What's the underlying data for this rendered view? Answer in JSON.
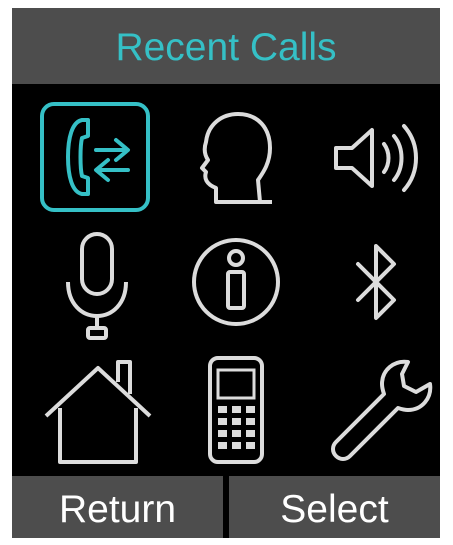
{
  "title": "Recent Calls",
  "softkeys": {
    "left_label": "Return",
    "right_label": "Select"
  },
  "menu": {
    "items": [
      {
        "icon": "call-transfer-icon",
        "selected": true
      },
      {
        "icon": "contact-profile-icon",
        "selected": false
      },
      {
        "icon": "speaker-volume-icon",
        "selected": false
      },
      {
        "icon": "microphone-icon",
        "selected": false
      },
      {
        "icon": "info-icon",
        "selected": false
      },
      {
        "icon": "bluetooth-icon",
        "selected": false
      },
      {
        "icon": "home-icon",
        "selected": false
      },
      {
        "icon": "handset-phone-icon",
        "selected": false
      },
      {
        "icon": "wrench-settings-icon",
        "selected": false
      }
    ]
  },
  "colors": {
    "accent": "#35c0c6",
    "background": "#000000",
    "bar": "#4d4d4d",
    "icon": "#dcdcdc"
  }
}
